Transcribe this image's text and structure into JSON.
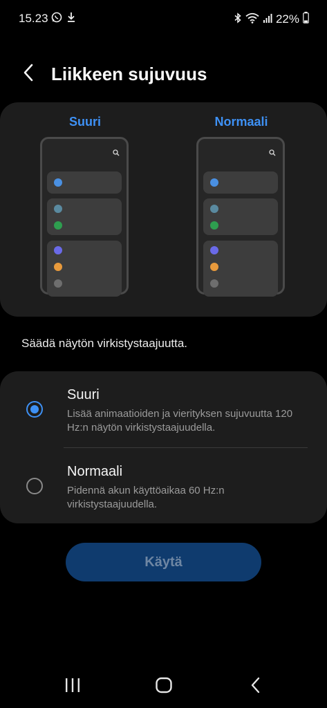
{
  "status_bar": {
    "time": "15.23",
    "battery": "22%",
    "icons": [
      "whatsapp-icon",
      "download-icon",
      "bluetooth-icon",
      "wifi-icon",
      "signal-icon",
      "battery-icon"
    ]
  },
  "header": {
    "back_icon": "back-chevron-icon",
    "title": "Liikkeen sujuvuus"
  },
  "preview": {
    "high_label": "Suuri",
    "standard_label": "Normaali"
  },
  "description": "Säädä näytön virkistystaajuutta.",
  "options": [
    {
      "title": "Suuri",
      "description": "Lisää animaatioiden ja vierityksen sujuvuutta 120 Hz:n näytön virkistystaajuudella.",
      "selected": true
    },
    {
      "title": "Normaali",
      "description": "Pidennä akun käyttöaikaa 60 Hz:n virkistystaajuudella.",
      "selected": false
    }
  ],
  "apply_button": {
    "label": "Käytä",
    "enabled": false
  },
  "nav_bar": {
    "icons": [
      "recent-apps-icon",
      "home-icon",
      "back-icon"
    ]
  },
  "colors": {
    "accent": "#3e91f5",
    "background": "#000000",
    "card": "#1d1d1d",
    "button_disabled": "#0f3b6e",
    "dot_blue": "#4a90e2",
    "dot_teal": "#5a8aa0",
    "dot_green": "#2e9e4f",
    "dot_purple": "#6a6ae8",
    "dot_orange": "#e89a3c",
    "dot_gray": "#6e6e6e"
  }
}
